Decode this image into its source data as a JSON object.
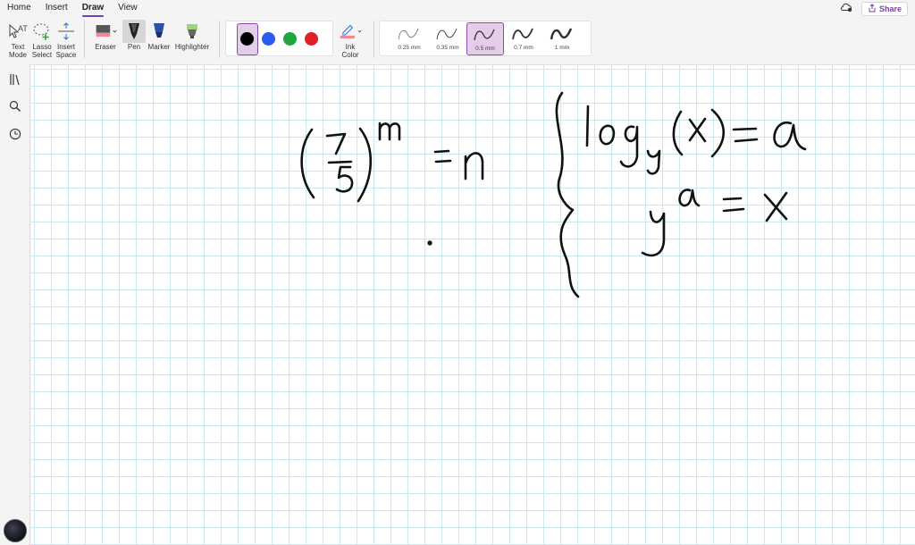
{
  "menu": {
    "tabs": [
      {
        "label": "Home"
      },
      {
        "label": "Insert"
      },
      {
        "label": "Draw"
      },
      {
        "label": "View"
      }
    ],
    "active_tab": "Draw",
    "share_label": "Share"
  },
  "ribbon": {
    "text_mode": "Text Mode",
    "lasso_select": "Lasso Select",
    "insert_space": "Insert Space",
    "eraser": "Eraser",
    "pen": "Pen",
    "marker": "Marker",
    "highlighter": "Highlighter",
    "ink_color": "Ink Color",
    "colors": [
      "#000000",
      "#2a5cf0",
      "#1fa83a",
      "#e01f26"
    ],
    "thickness": [
      "0.25 mm",
      "0.35 mm",
      "0.5 mm",
      "0.7 mm",
      "1 mm"
    ],
    "selected_thickness": "0.5 mm"
  },
  "sidebar": {
    "icons": [
      "library-icon",
      "search-icon",
      "recent-icon"
    ]
  }
}
